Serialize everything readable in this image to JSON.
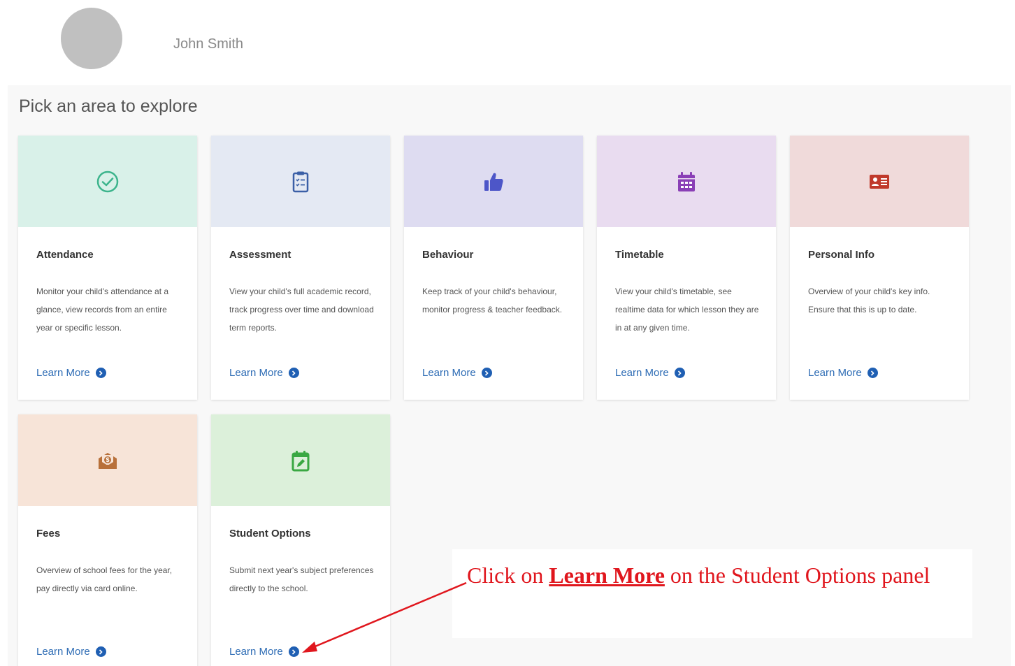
{
  "user": {
    "name": "John Smith"
  },
  "panel": {
    "title": "Pick an area to explore"
  },
  "link_label": "Learn More",
  "cards": [
    {
      "key": "attendance",
      "title": "Attendance",
      "description": "Monitor your child's attendance at a glance, view records from an entire year or specific lesson.",
      "head_color": "#d9f1e9",
      "icon_color": "#3cb48c",
      "icon": "check-circle-icon"
    },
    {
      "key": "assessment",
      "title": "Assessment",
      "description": "View your child's full academic record, track progress over time and download term reports.",
      "head_color": "#e4e9f3",
      "icon_color": "#3a5fa6",
      "icon": "clipboard-icon"
    },
    {
      "key": "behaviour",
      "title": "Behaviour",
      "description": "Keep track of your child's behaviour, monitor progress & teacher feedback.",
      "head_color": "#dedcf1",
      "icon_color": "#4d56c8",
      "icon": "thumbs-up-icon"
    },
    {
      "key": "timetable",
      "title": "Timetable",
      "description": "View your child's timetable, see realtime data for which lesson they are in at any given time.",
      "head_color": "#e9dcf0",
      "icon_color": "#8a3fb6",
      "icon": "calendar-icon"
    },
    {
      "key": "personal-info",
      "title": "Personal Info",
      "description": "Overview of your child's key info. Ensure that this is up to date.",
      "head_color": "#f0dada",
      "icon_color": "#c0392b",
      "icon": "id-card-icon"
    },
    {
      "key": "fees",
      "title": "Fees",
      "description": "Overview of school fees for the year, pay directly via card online.",
      "head_color": "#f7e4d8",
      "icon_color": "#b8703a",
      "icon": "money-envelope-icon"
    },
    {
      "key": "student-options",
      "title": "Student Options",
      "description": "Submit next year's subject preferences directly to the school.",
      "head_color": "#dcf0da",
      "icon_color": "#3aa843",
      "icon": "calendar-edit-icon"
    }
  ],
  "callout": {
    "prefix": "Click on ",
    "emphasis": "Learn More",
    "suffix": " on the Student Options panel",
    "color": "#e0161d"
  }
}
